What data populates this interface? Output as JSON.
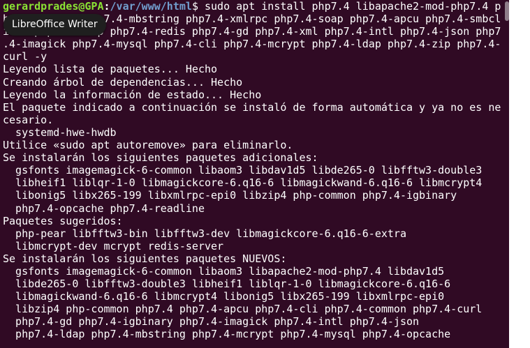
{
  "prompt": {
    "user_host": "gerardprades@GPA",
    "colon": ":",
    "path": "/var/www/html",
    "command": "$ sudo apt install php7.4 libapache2-mod-php7.4 p"
  },
  "lines": [
    "hp7.4-common php7.4-mbstring php7.4-xmlrpc php7.4-soap php7.4-apcu php7.4-smbcl",
    "ient php7.4-ldap php7.4-redis php7.4-gd php7.4-xml php7.4-intl php7.4-json php7",
    ".4-imagick php7.4-mysql php7.4-cli php7.4-mcrypt php7.4-ldap php7.4-zip php7.4-",
    "curl -y",
    "Leyendo lista de paquetes... Hecho",
    "Creando árbol de dependencias... Hecho",
    "Leyendo la información de estado... Hecho",
    "El paquete indicado a continuación se instaló de forma automática y ya no es ne",
    "cesario.",
    "  systemd-hwe-hwdb",
    "Utilice «sudo apt autoremove» para eliminarlo.",
    "Se instalarán los siguientes paquetes adicionales:",
    "  gsfonts imagemagick-6-common libaom3 libdav1d5 libde265-0 libfftw3-double3",
    "  libheif1 liblqr-1-0 libmagickcore-6.q16-6 libmagickwand-6.q16-6 libmcrypt4",
    "  libonig5 libx265-199 libxmlrpc-epi0 libzip4 php-common php7.4-igbinary",
    "  php7.4-opcache php7.4-readline",
    "Paquetes sugeridos:",
    "  php-pear libfftw3-bin libfftw3-dev libmagickcore-6.q16-6-extra",
    "  libmcrypt-dev mcrypt redis-server",
    "Se instalarán los siguientes paquetes NUEVOS:",
    "  gsfonts imagemagick-6-common libaom3 libapache2-mod-php7.4 libdav1d5",
    "  libde265-0 libfftw3-double3 libheif1 liblqr-1-0 libmagickcore-6.q16-6",
    "  libmagickwand-6.q16-6 libmcrypt4 libonig5 libx265-199 libxmlrpc-epi0",
    "  libzip4 php-common php7.4 php7.4-apcu php7.4-cli php7.4-common php7.4-curl",
    "  php7.4-gd php7.4-igbinary php7.4-imagick php7.4-intl php7.4-json",
    "  php7.4-ldap php7.4-mbstring php7.4-mcrypt php7.4-mysql php7.4-opcache"
  ],
  "tooltip": {
    "label": "LibreOffice Writer"
  },
  "colors": {
    "background": "#300a24",
    "prompt_user": "#8ae234",
    "prompt_path": "#729fcf",
    "text": "#ffffff"
  }
}
